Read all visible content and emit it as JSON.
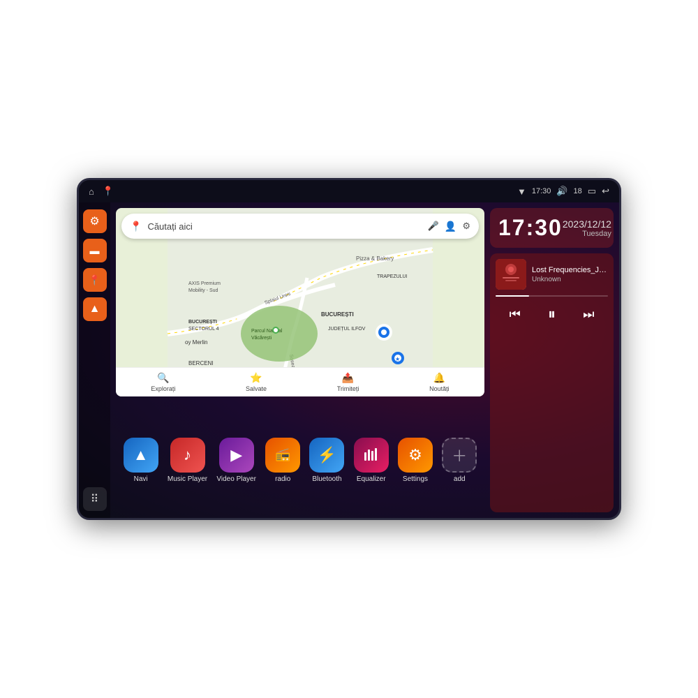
{
  "device": {
    "status_bar": {
      "left_icons": [
        "⌂",
        "📍"
      ],
      "signal_icon": "▼",
      "time": "17:30",
      "volume_icon": "🔊",
      "battery_level": "18",
      "battery_icon": "🔋",
      "back_icon": "↩"
    },
    "sidebar": {
      "buttons": [
        {
          "id": "settings",
          "icon": "⚙",
          "type": "orange"
        },
        {
          "id": "files",
          "icon": "▬",
          "type": "orange"
        },
        {
          "id": "location",
          "icon": "📍",
          "type": "orange"
        },
        {
          "id": "nav",
          "icon": "▲",
          "type": "orange"
        },
        {
          "id": "apps",
          "icon": "⠿",
          "type": "dark"
        }
      ]
    },
    "map": {
      "search_placeholder": "Căutați aici",
      "nav_items": [
        {
          "label": "Explorați",
          "icon": "🔍"
        },
        {
          "label": "Salvate",
          "icon": "⭐"
        },
        {
          "label": "Trimiteți",
          "icon": "📤"
        },
        {
          "label": "Noutăți",
          "icon": "🔔"
        }
      ],
      "locations": [
        "AXIS Premium Mobility - Sud",
        "Parcul Natural Văcărești",
        "Pizza & Bakery",
        "BUCUREȘTI SECTORUL 4",
        "BUCUREȘTI",
        "JUDEȚUL ILFOV",
        "BERCENI",
        "TRAPEZULUI"
      ]
    },
    "apps": [
      {
        "id": "navi",
        "label": "Navi",
        "icon": "▲",
        "style": "icon-blue"
      },
      {
        "id": "music",
        "label": "Music Player",
        "icon": "♪",
        "style": "icon-red"
      },
      {
        "id": "video",
        "label": "Video Player",
        "icon": "▶",
        "style": "icon-purple"
      },
      {
        "id": "radio",
        "label": "radio",
        "icon": "📻",
        "style": "icon-orange"
      },
      {
        "id": "bluetooth",
        "label": "Bluetooth",
        "icon": "⚡",
        "style": "icon-bt"
      },
      {
        "id": "equalizer",
        "label": "Equalizer",
        "icon": "≡",
        "style": "icon-eq"
      },
      {
        "id": "settings",
        "label": "Settings",
        "icon": "⚙",
        "style": "icon-settings"
      },
      {
        "id": "add",
        "label": "add",
        "icon": "+",
        "style": "icon-add"
      }
    ],
    "clock": {
      "time": "17:30",
      "date": "2023/12/12",
      "day": "Tuesday"
    },
    "music_player": {
      "title": "Lost Frequencies_Janie...",
      "artist": "Unknown",
      "progress": 30
    }
  }
}
